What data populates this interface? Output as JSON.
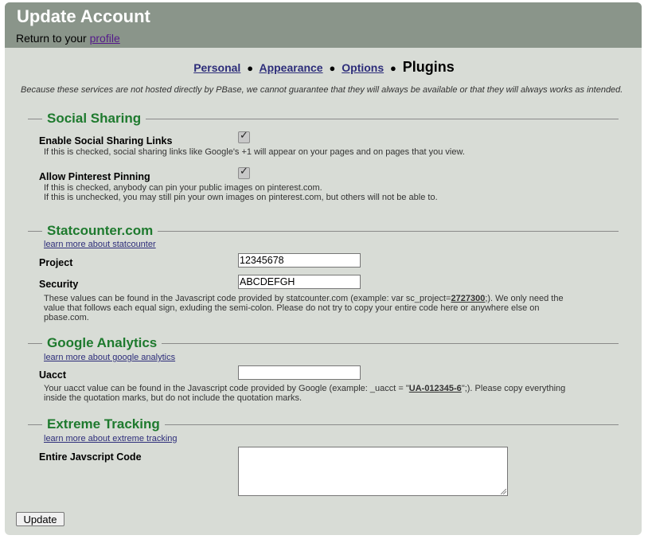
{
  "header": {
    "title": "Update Account",
    "return_prefix": "Return to your ",
    "return_link": "profile"
  },
  "tabs": {
    "personal": "Personal",
    "appearance": "Appearance",
    "options": "Options",
    "current": "Plugins",
    "separator": "●"
  },
  "disclaimer": "Because these services are not hosted directly by PBase, we cannot guarantee that they will always be available or that they will always works as intended.",
  "social": {
    "heading": "Social Sharing",
    "sharing_label": "Enable Social Sharing Links",
    "sharing_checked": true,
    "sharing_help": "If this is checked, social sharing links like Google's +1 will appear on your pages and on pages that you view.",
    "pinterest_label": "Allow Pinterest Pinning",
    "pinterest_checked": true,
    "pinterest_help_1": "If this is checked, anybody can pin your public images on pinterest.com.",
    "pinterest_help_2": "If this is unchecked, you may still pin your own images on pinterest.com, but others will not be able to."
  },
  "statcounter": {
    "heading": "Statcounter.com",
    "learn_more": "learn more about statcounter",
    "project_label": "Project",
    "project_value": "12345678",
    "security_label": "Security",
    "security_value": "ABCDEFGH",
    "help_pre": "These values can be found in the Javascript code provided by statcounter.com (example: var sc_project=",
    "help_example": "2727300",
    "help_post_1": ";). We only need the",
    "help_line2": "value that follows each equal sign, exluding the semi-colon. Please do not try to copy your entire code here or anywhere else on",
    "help_line3": "pbase.com."
  },
  "analytics": {
    "heading": "Google Analytics",
    "learn_more": "learn more about google analytics",
    "uacct_label": "Uacct",
    "uacct_value": "",
    "help_pre": "Your uacct value can be found in the Javascript code provided by Google (example: _uacct = \"",
    "help_example": "UA-012345-6",
    "help_post": "\";). Please copy everything",
    "help_line2": "inside the quotation marks, but do not include the quotation marks."
  },
  "extreme": {
    "heading": "Extreme Tracking",
    "learn_more": "learn more about extreme tracking",
    "code_label": "Entire Javscript Code",
    "code_value": ""
  },
  "footer": {
    "update_label": "Update"
  },
  "colors": {
    "header_bg": "#8a958a",
    "panel_bg": "#d8dcd6",
    "section_heading": "#1e7a2e",
    "link": "#2d2d7a"
  }
}
